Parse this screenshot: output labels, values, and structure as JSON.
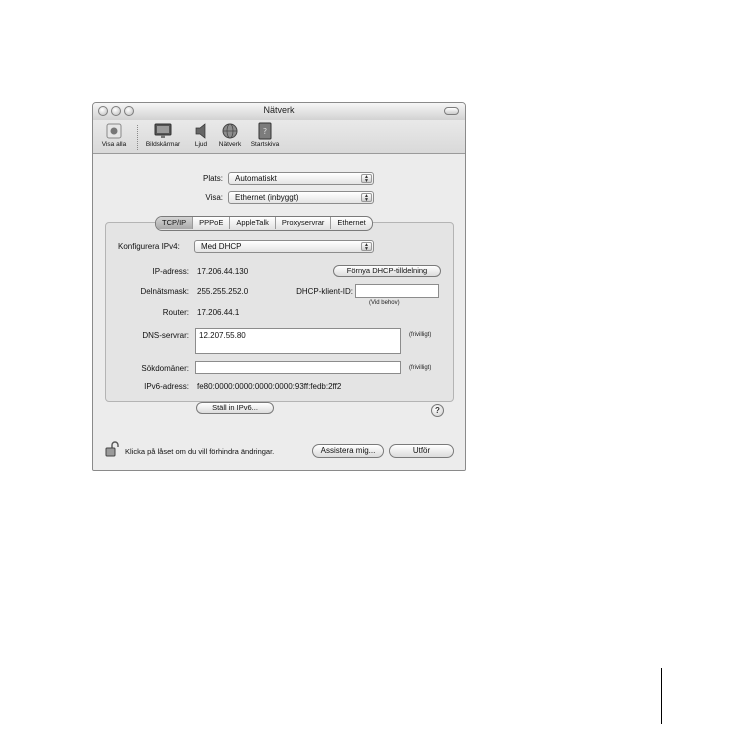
{
  "window": {
    "title": "Nätverk"
  },
  "toolbar": {
    "items": [
      {
        "label": "Visa alla",
        "icon": "apple-grid-icon"
      },
      {
        "label": "Bildskärmar",
        "icon": "display-icon"
      },
      {
        "label": "Ljud",
        "icon": "speaker-icon"
      },
      {
        "label": "Nätverk",
        "icon": "network-globe-icon"
      },
      {
        "label": "Startskiva",
        "icon": "startup-disk-icon"
      }
    ]
  },
  "location": {
    "label": "Plats:",
    "value": "Automatiskt"
  },
  "show": {
    "label": "Visa:",
    "value": "Ethernet (inbyggt)"
  },
  "tabs": [
    {
      "label": "TCP/IP",
      "selected": true
    },
    {
      "label": "PPPoE",
      "selected": false
    },
    {
      "label": "AppleTalk",
      "selected": false
    },
    {
      "label": "Proxyservrar",
      "selected": false
    },
    {
      "label": "Ethernet",
      "selected": false
    }
  ],
  "tcpip": {
    "configure_label": "Konfigurera IPv4:",
    "configure_value": "Med DHCP",
    "ip_label": "IP-adress:",
    "ip_value": "17.206.44.130",
    "renew_button": "Förnya DHCP-tilldelning",
    "subnet_label": "Delnätsmask:",
    "subnet_value": "255.255.252.0",
    "client_id_label": "DHCP-klient-ID:",
    "client_id_value": "",
    "client_id_hint": "(Vid behov)",
    "router_label": "Router:",
    "router_value": "17.206.44.1",
    "dns_label": "DNS-servrar:",
    "dns_value": "12.207.55.80",
    "dns_hint": "(frivilligt)",
    "search_label": "Sökdomäner:",
    "search_value": "",
    "search_hint": "(frivilligt)",
    "ipv6_label": "IPv6-adress:",
    "ipv6_value": "fe80:0000:0000:0000:0000:93ff:fedb:2ff2",
    "ipv6_button": "Ställ in IPv6...",
    "help": "?"
  },
  "footer": {
    "lock_text": "Klicka på låset om du vill förhindra ändringar.",
    "assist_button": "Assistera mig...",
    "apply_button": "Utför"
  }
}
